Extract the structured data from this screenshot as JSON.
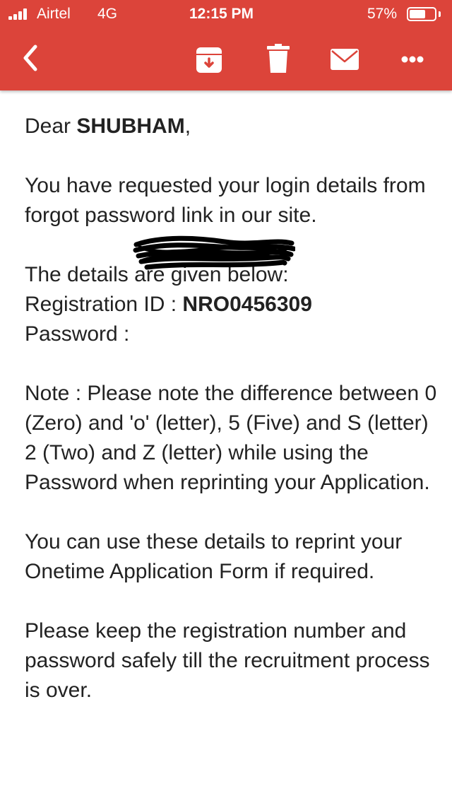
{
  "status_bar": {
    "carrier": "Airtel",
    "network": "4G",
    "time": "12:15 PM",
    "battery_percent": "57%"
  },
  "toolbar": {
    "icons": [
      "back-arrow-icon",
      "archive-icon",
      "trash-icon",
      "envelope-icon",
      "more-icon"
    ]
  },
  "email": {
    "greeting_prefix": "Dear ",
    "name": "SHUBHAM",
    "greeting_suffix": ",",
    "para1": "You have requested your login details from forgot password link in our site.",
    "details_intro": "The details are given below:",
    "reg_label": "Registration ID : ",
    "reg_value": "NRO0456309",
    "password_label": "Password :",
    "note": "Note : Please note the difference between 0 (Zero) and 'o' (letter), 5 (Five) and S (letter) 2 (Two) and Z (letter) while using the Password when reprinting your Application.",
    "para_reprint": "You can use these details to reprint your Onetime Application Form if required.",
    "para_keep": "Please keep the registration number and password safely till the recruitment process is over."
  },
  "colors": {
    "header_bg": "#dc443a",
    "text": "#222222",
    "icon_white": "#ffffff"
  }
}
